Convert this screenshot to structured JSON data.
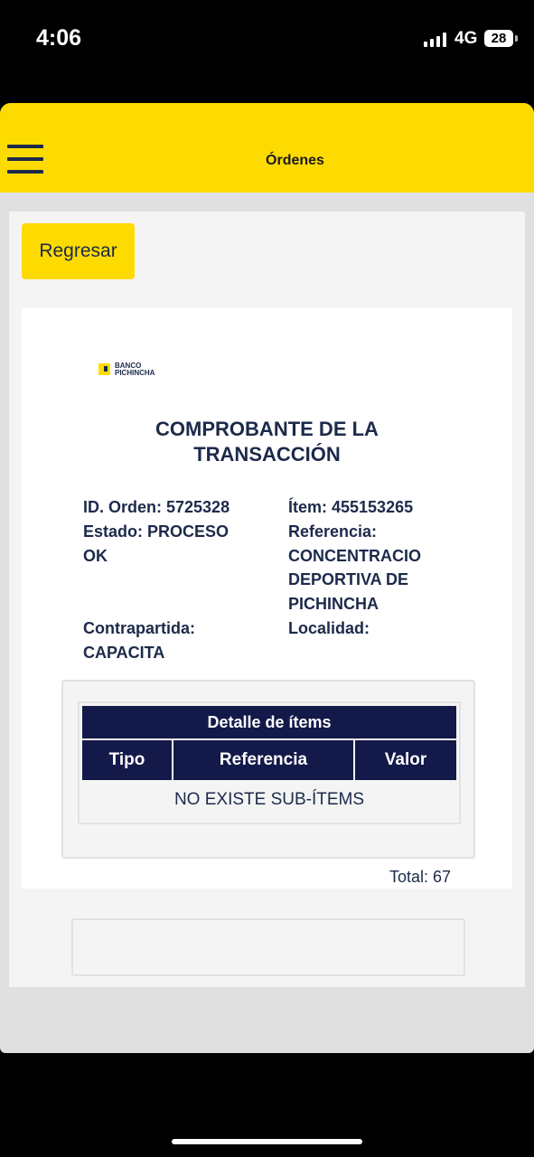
{
  "status_bar": {
    "time": "4:06",
    "network": "4G",
    "battery": "28"
  },
  "header": {
    "title": "Órdenes",
    "menu_icon": "hamburger-icon"
  },
  "back_button": {
    "label": "Regresar"
  },
  "receipt": {
    "logo": {
      "line1": "BANCO",
      "line2": "PICHINCHA"
    },
    "title": "COMPROBANTE DE LA TRANSACCIÓN",
    "order_id": "ID. Orden: 5725328",
    "status": "Estado: PROCESO OK",
    "item": "Ítem: 455153265",
    "reference": "Referencia: CONCENTRACIO DEPORTIVA DE PICHINCHA",
    "counterpart": "Contrapartida: CAPACITA",
    "locality": "Localidad:",
    "details": {
      "title": "Detalle de ítems",
      "columns": [
        "Tipo",
        "Referencia",
        "Valor"
      ],
      "empty_text": "NO EXISTE SUB-ÍTEMS"
    },
    "total": "Total: 67"
  },
  "colors": {
    "brand_yellow": "#fedb00",
    "navy": "#131949",
    "text_navy": "#1c2a4a"
  }
}
